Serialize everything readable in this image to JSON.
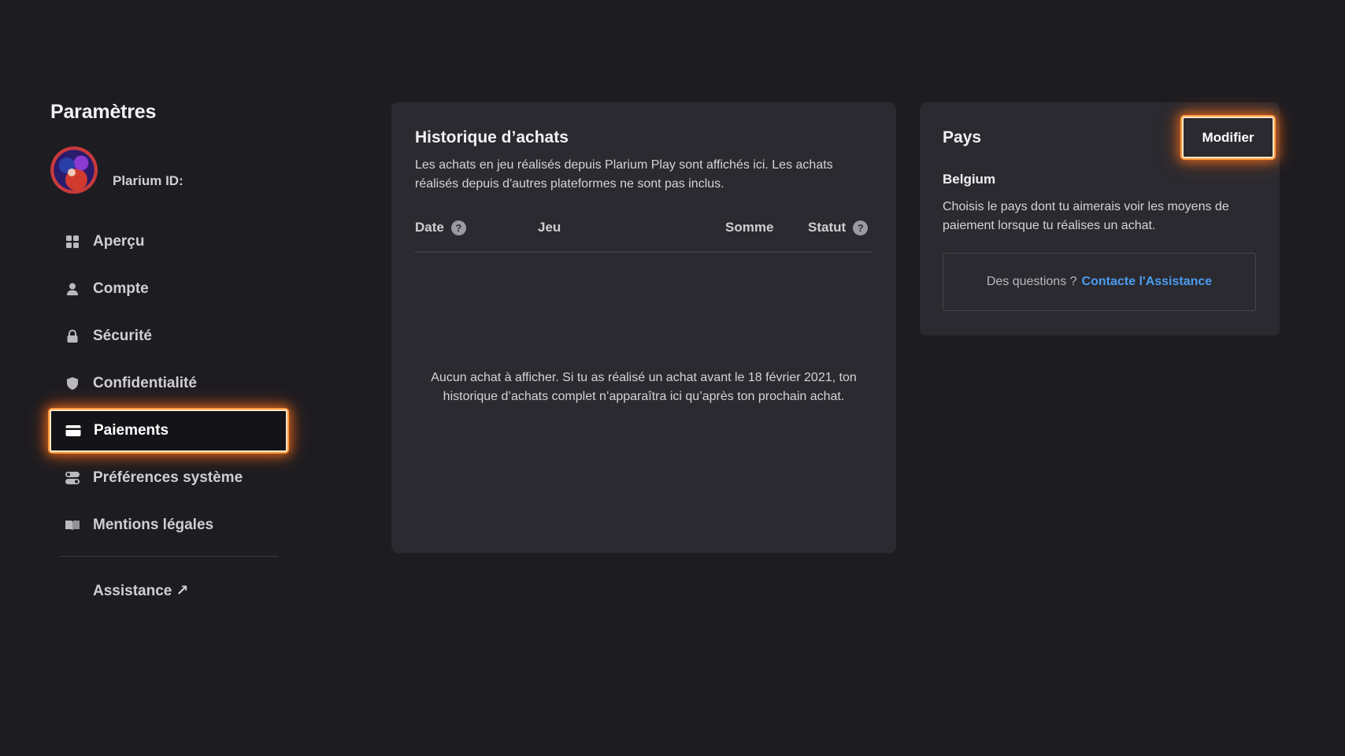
{
  "sidebar": {
    "title": "Paramètres",
    "profile": {
      "label": "Plarium ID:"
    },
    "items": [
      {
        "label": "Aperçu",
        "icon": "grid-icon"
      },
      {
        "label": "Compte",
        "icon": "user-icon"
      },
      {
        "label": "Sécurité",
        "icon": "lock-icon"
      },
      {
        "label": "Confidentialité",
        "icon": "shield-icon"
      },
      {
        "label": "Paiements",
        "icon": "credit-card-icon",
        "active": true
      },
      {
        "label": "Préférences système",
        "icon": "toggles-icon"
      },
      {
        "label": "Mentions légales",
        "icon": "book-icon"
      }
    ],
    "assistance_label": "Assistance ↗"
  },
  "history": {
    "title": "Historique d’achats",
    "description": "Les achats en jeu réalisés depuis Plarium Play sont affichés ici. Les achats réalisés depuis d'autres plateformes ne sont pas inclus.",
    "columns": {
      "date": "Date",
      "game": "Jeu",
      "sum": "Somme",
      "status": "Statut"
    },
    "help_glyph": "?",
    "empty_message": "Aucun achat à afficher. Si tu as réalisé un achat avant le 18 février 2021, ton historique d’achats complet n’apparaîtra ici qu’après ton prochain achat."
  },
  "country": {
    "title": "Pays",
    "modify_label": "Modifier",
    "value": "Belgium",
    "description": "Choisis le pays dont tu aimerais voir les moyens de paiement lorsque tu réalises un achat.",
    "support_question": "Des questions ?",
    "support_link": "Contacte l'Assistance"
  },
  "colors": {
    "background": "#1c1c21",
    "card": "#2a2a30",
    "focus_glow": "#ff9a3d",
    "link": "#4d9cf0"
  }
}
